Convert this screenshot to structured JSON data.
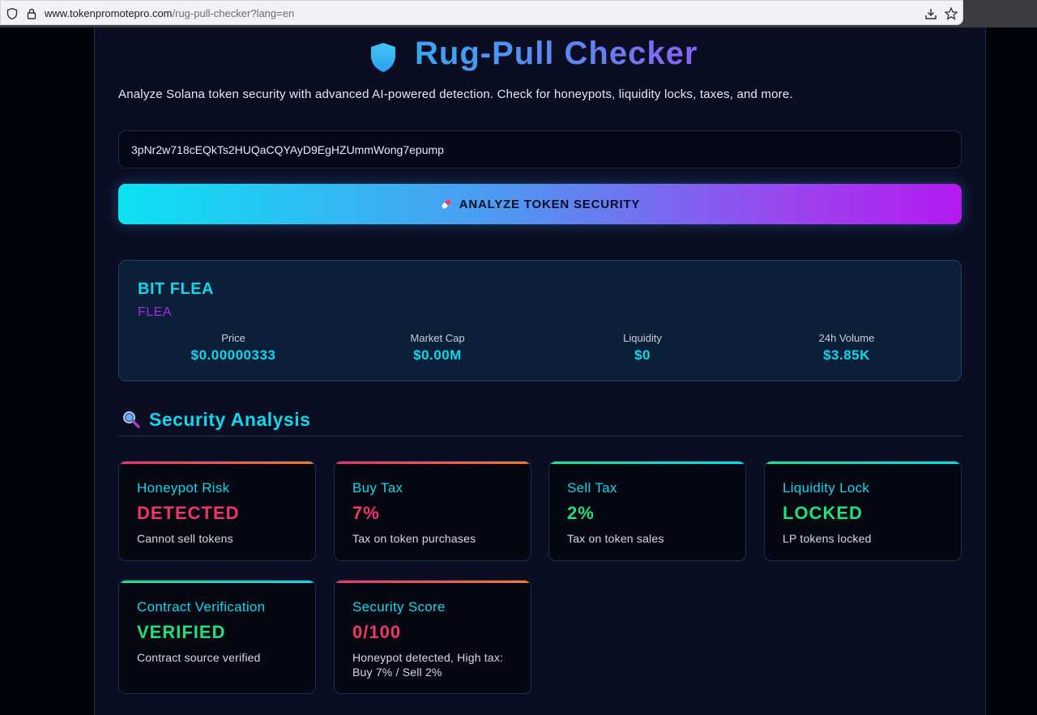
{
  "browser": {
    "url_host": "www.tokenpromotepro.com",
    "url_path": "/rug-pull-checker?lang=en"
  },
  "header": {
    "title": "Rug-Pull Checker",
    "subtitle": "Analyze Solana token security with advanced AI-powered detection. Check for honeypots, liquidity locks, taxes, and more."
  },
  "search": {
    "value": "3pNr2w718cEQkTs2HUQaCQYAyD9EgHZUmmWong7epump"
  },
  "analyze_button": {
    "label": "ANALYZE TOKEN SECURITY"
  },
  "token": {
    "name": "BIT FLEA",
    "symbol": "FLEA",
    "stats": [
      {
        "label": "Price",
        "value": "$0.00000333"
      },
      {
        "label": "Market Cap",
        "value": "$0.00M"
      },
      {
        "label": "Liquidity",
        "value": "$0"
      },
      {
        "label": "24h Volume",
        "value": "$3.85K"
      }
    ]
  },
  "security": {
    "heading": "Security Analysis",
    "cards": [
      {
        "title": "Honeypot Risk",
        "value": "DETECTED",
        "desc": "Cannot sell tokens",
        "status": "danger"
      },
      {
        "title": "Buy Tax",
        "value": "7%",
        "desc": "Tax on token purchases",
        "status": "danger"
      },
      {
        "title": "Sell Tax",
        "value": "2%",
        "desc": "Tax on token sales",
        "status": "ok"
      },
      {
        "title": "Liquidity Lock",
        "value": "LOCKED",
        "desc": "LP tokens locked",
        "status": "ok"
      },
      {
        "title": "Contract Verification",
        "value": "VERIFIED",
        "desc": "Contract source verified",
        "status": "ok"
      },
      {
        "title": "Security Score",
        "value": "0/100",
        "desc": "Honeypot detected, High tax: Buy 7% / Sell 2%",
        "status": "danger"
      }
    ]
  },
  "colors": {
    "accent_cyan": "#12d6ea",
    "accent_purple": "#a02cf0",
    "danger": "#f0366a",
    "success": "#1fe07e"
  }
}
